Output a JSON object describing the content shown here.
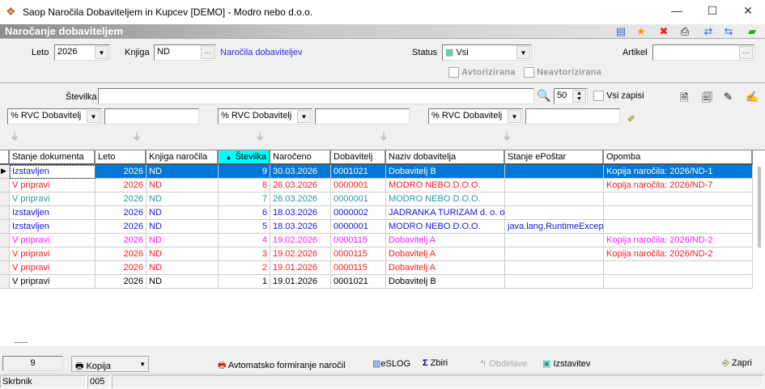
{
  "window": {
    "title": "Saop  Naročila Dobaviteljem in Kupcev [DEMO] - Modro nebo d.o.o.",
    "min": "—",
    "max": "☐",
    "close": "✕"
  },
  "header": {
    "title": "Naročanje dobaviteljem"
  },
  "form": {
    "leto_label": "Leto",
    "leto_value": "2026",
    "knjiga_label": "Knjiga",
    "knjiga_value": "ND",
    "knjiga_desc": "Naročila dobaviteljev",
    "status_label": "Status",
    "status_value": "Vsi",
    "artikel_label": "Artikel",
    "artikel_value": "",
    "avtorizirana": "Avtorizirana",
    "neavtorizirana": "Neavtorizirana",
    "stevilka_label": "Številka",
    "stevilka_value": "",
    "limit": "50",
    "vsi_zapisi": "Vsi zapisi",
    "ellipsis": "···"
  },
  "filters": [
    {
      "field": "% RVC Dobavitelj",
      "value": ""
    },
    {
      "field": "% RVC Dobavitelj",
      "value": ""
    },
    {
      "field": "% RVC Dobavitelj",
      "value": ""
    }
  ],
  "grid": {
    "columns": [
      "Stanje dokumenta",
      "Leto",
      "Knjiga naročila",
      "Številka",
      "Naročeno",
      "Dobavitelj",
      "Naziv dobavitelja",
      "Stanje ePoštar",
      "Opomba"
    ],
    "sort_indicator": "▲",
    "rows": [
      {
        "color": "#1515e0",
        "selected": true,
        "cells": [
          "Izstavljen",
          "2026",
          "ND",
          "9",
          "30.03.2026",
          "0001021",
          "Dobavitelj B",
          "",
          "Kopija naročila: 2026/ND-1"
        ]
      },
      {
        "color": "#ff1a1a",
        "cells": [
          "V pripravi",
          "2026",
          "ND",
          "8",
          "26.03.2026",
          "0000001",
          "MODRO NEBO D.O.O.",
          "",
          "Kopija naročila: 2026/ND-7"
        ]
      },
      {
        "color": "#2a9a9a",
        "cells": [
          "V pripravi",
          "2026",
          "ND",
          "7",
          "26.03.2026",
          "0000001",
          "MODRO NEBO D.O.O.",
          "",
          ""
        ]
      },
      {
        "color": "#1515e0",
        "cells": [
          "Izstavljen",
          "2026",
          "ND",
          "6",
          "18.03.2026",
          "0000002",
          "JADRANKA TURIZAM d. o. o.",
          "",
          ""
        ]
      },
      {
        "color": "#1515e0",
        "cells": [
          "Izstavljen",
          "2026",
          "ND",
          "5",
          "18.03.2026",
          "0000001",
          "MODRO NEBO D.O.O.",
          "java.lang.RuntimeException",
          ""
        ]
      },
      {
        "color": "#ff1aff",
        "cells": [
          "V pripravi",
          "2026",
          "ND",
          "4",
          "19.02.2026",
          "0000115",
          "Dobavitelj A",
          "",
          "Kopija naročila: 2026/ND-2"
        ]
      },
      {
        "color": "#ff1a1a",
        "cells": [
          "V pripravi",
          "2026",
          "ND",
          "3",
          "19.02.2026",
          "0000115",
          "Dobavitelj A",
          "",
          "Kopija naročila: 2026/ND-2"
        ]
      },
      {
        "color": "#ff1a1a",
        "cells": [
          "V pripravi",
          "2026",
          "ND",
          "2",
          "19.01.2026",
          "0000115",
          "Dobavitelj A",
          "",
          ""
        ]
      },
      {
        "color": "#000000",
        "cells": [
          "V pripravi",
          "2026",
          "ND",
          "1",
          "19.01.2026",
          "0001021",
          "Dobavitelj B",
          "",
          ""
        ]
      }
    ]
  },
  "footer": {
    "count": "9",
    "kopija": "Kopija",
    "avtomatsko": "Avtomatsko formiranje naročil",
    "eslog": "eSLOG",
    "zbiri": "Zbiri",
    "obdelave": "Obdelave",
    "izstavitev": "Izstavitev",
    "zapri": "Zapri"
  },
  "statusbar": {
    "label": "Skrbnik",
    "code": "005"
  }
}
